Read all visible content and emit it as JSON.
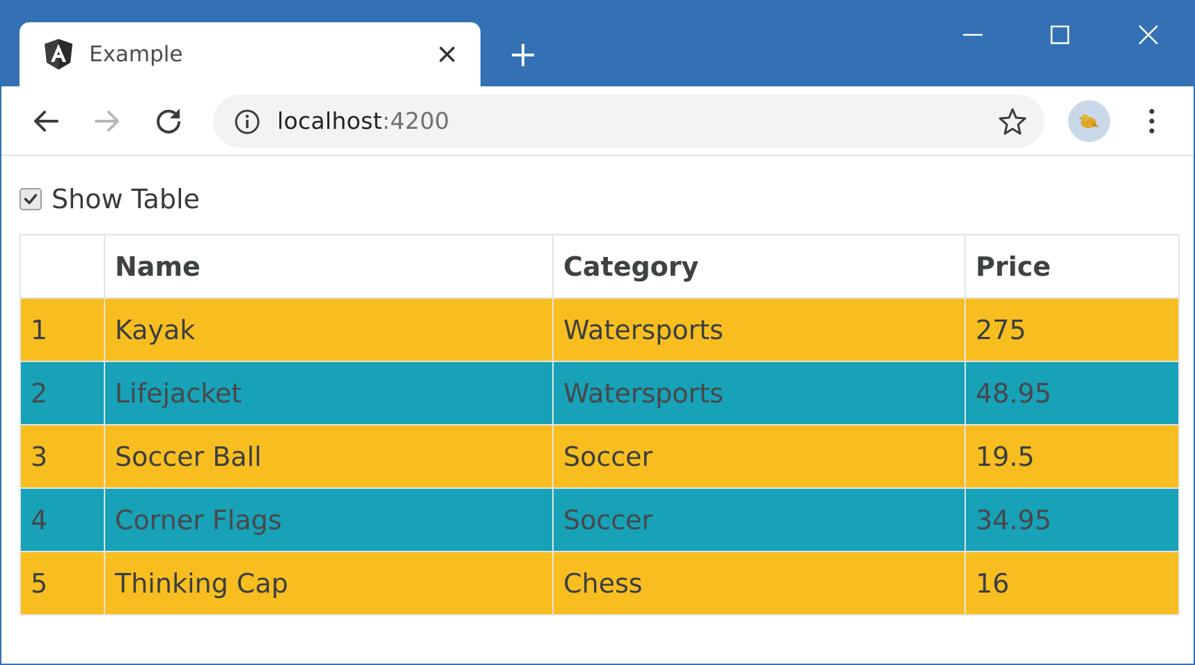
{
  "browser": {
    "tab_title": "Example",
    "url_host": "localhost",
    "url_port": ":4200",
    "icons": {
      "favicon": "angular-logo-icon",
      "tab_close": "close-icon",
      "new_tab": "plus-icon",
      "back": "back-arrow-icon",
      "forward": "forward-arrow-icon",
      "reload": "reload-icon",
      "site_info": "info-icon",
      "bookmark": "star-icon",
      "menu": "vertical-dots-icon"
    },
    "colors": {
      "titlebar": "#3371b4",
      "omnibox": "#f1f3f4"
    }
  },
  "page": {
    "show_table_label": "Show Table",
    "show_table_checked": true,
    "table": {
      "headers": [
        "",
        "Name",
        "Category",
        "Price"
      ],
      "rows": [
        {
          "index": "1",
          "name": "Kayak",
          "category": "Watersports",
          "price": "275",
          "style": "warning"
        },
        {
          "index": "2",
          "name": "Lifejacket",
          "category": "Watersports",
          "price": "48.95",
          "style": "info"
        },
        {
          "index": "3",
          "name": "Soccer Ball",
          "category": "Soccer",
          "price": "19.5",
          "style": "warning"
        },
        {
          "index": "4",
          "name": "Corner Flags",
          "category": "Soccer",
          "price": "34.95",
          "style": "info"
        },
        {
          "index": "5",
          "name": "Thinking Cap",
          "category": "Chess",
          "price": "16",
          "style": "warning"
        }
      ]
    },
    "colors": {
      "warning_row": "#f8be20",
      "info_row": "#17a2b8"
    }
  }
}
